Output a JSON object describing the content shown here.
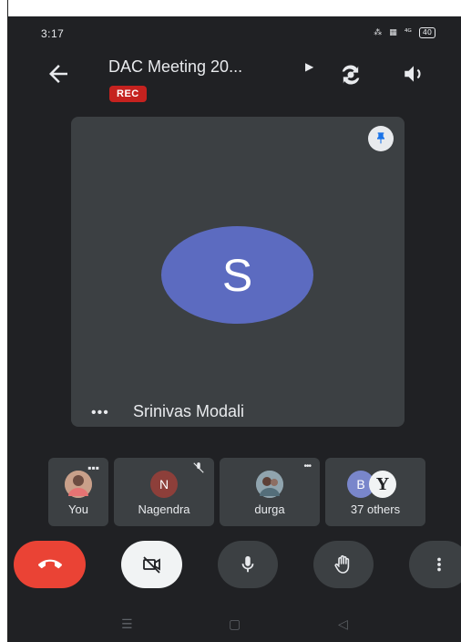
{
  "status_bar": {
    "time": "3:17",
    "signal_text": "⁴ᴳ",
    "battery": "40"
  },
  "header": {
    "title": "DAC Meeting 20...",
    "rec_badge": "REC"
  },
  "main_tile": {
    "avatar_letter": "S",
    "participant_name": "Srinivas Modali",
    "more_dots": "•••"
  },
  "participants": [
    {
      "label": "You",
      "avatar": ""
    },
    {
      "label": "Nagendra",
      "avatar": "N"
    },
    {
      "label": "durga",
      "avatar": ""
    },
    {
      "label": "37 others",
      "avatar_b": "B",
      "avatar_y": "Y"
    }
  ],
  "thumb_dots": "•••",
  "icons": {
    "back": "arrow-back-icon",
    "flip": "camera-flip-icon",
    "speaker": "speaker-icon",
    "pin": "pin-icon",
    "end": "end-call-icon",
    "camera": "camera-off-icon",
    "mic": "microphone-icon",
    "hand": "raise-hand-icon",
    "more": "more-vert-icon"
  },
  "colors": {
    "rec": "#c5221f",
    "end_call": "#ea4335",
    "avatar_s": "#5c6bc0"
  }
}
